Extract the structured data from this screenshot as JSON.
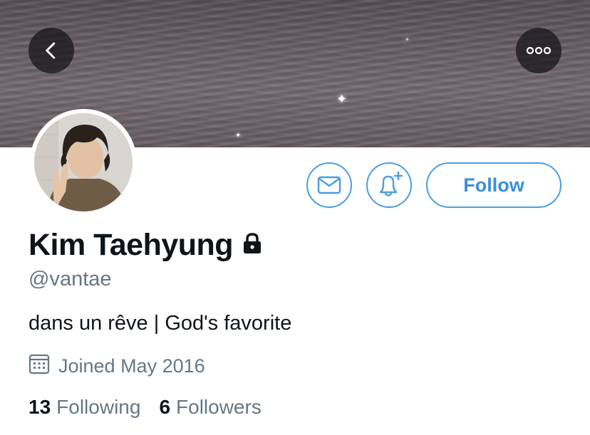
{
  "colors": {
    "accent": "#4b9de0",
    "secondary_text": "#657786",
    "primary_text": "#0f1419",
    "overlay_button": "#141418"
  },
  "header": {
    "back_icon": "chevron-left-icon",
    "more_icon": "more-horizontal-icon"
  },
  "actions": {
    "message_icon": "mail-icon",
    "notify_icon": "bell-plus-icon",
    "follow_label": "Follow"
  },
  "profile": {
    "display_name": "Kim Taehyung",
    "protected_icon": "lock-icon",
    "handle": "@vantae",
    "bio": "dans un rêve | God's favorite",
    "joined_icon": "calendar-icon",
    "joined": "Joined May 2016"
  },
  "stats": {
    "following_count": "13",
    "following_label": "Following",
    "followers_count": "6",
    "followers_label": "Followers"
  }
}
